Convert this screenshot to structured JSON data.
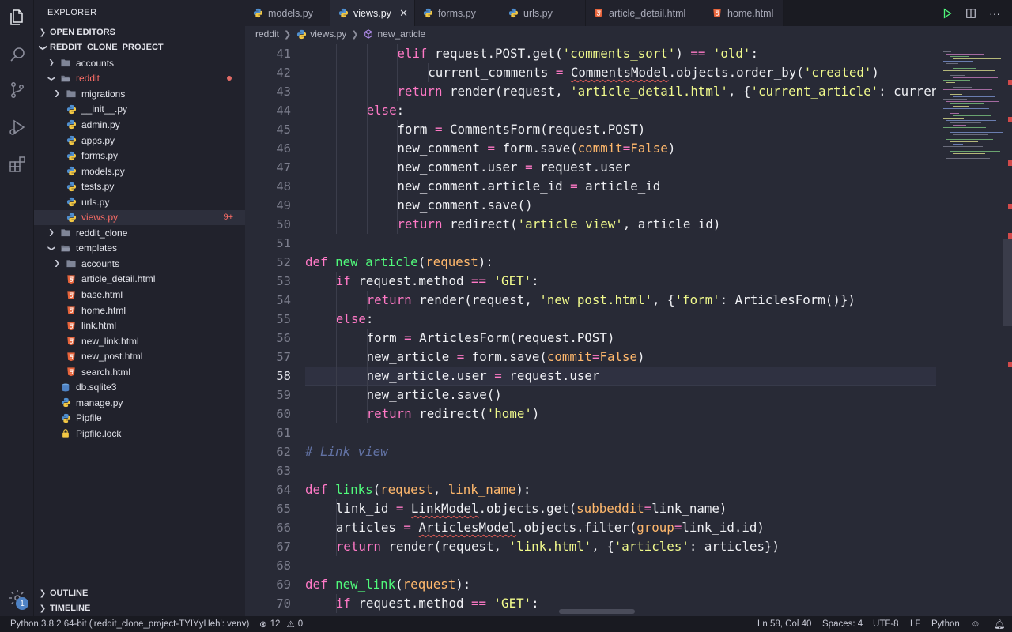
{
  "sidebar": {
    "header": "EXPLORER",
    "sections": {
      "open_editors": "OPEN EDITORS",
      "project": "REDDIT_CLONE_PROJECT",
      "outline": "OUTLINE",
      "timeline": "TIMELINE"
    },
    "tree": [
      {
        "label": "accounts",
        "type": "folder",
        "depth": 1,
        "expanded": false
      },
      {
        "label": "reddit",
        "type": "folder",
        "depth": 1,
        "expanded": true,
        "modified": true
      },
      {
        "label": "migrations",
        "type": "folder",
        "depth": 2,
        "expanded": false
      },
      {
        "label": "__init__.py",
        "type": "py",
        "depth": 2
      },
      {
        "label": "admin.py",
        "type": "py",
        "depth": 2
      },
      {
        "label": "apps.py",
        "type": "py",
        "depth": 2
      },
      {
        "label": "forms.py",
        "type": "py",
        "depth": 2
      },
      {
        "label": "models.py",
        "type": "py",
        "depth": 2
      },
      {
        "label": "tests.py",
        "type": "py",
        "depth": 2
      },
      {
        "label": "urls.py",
        "type": "py",
        "depth": 2
      },
      {
        "label": "views.py",
        "type": "py",
        "depth": 2,
        "active": true,
        "badge": "9+"
      },
      {
        "label": "reddit_clone",
        "type": "folder",
        "depth": 1,
        "expanded": false
      },
      {
        "label": "templates",
        "type": "folder",
        "depth": 1,
        "expanded": true
      },
      {
        "label": "accounts",
        "type": "folder",
        "depth": 2,
        "expanded": false
      },
      {
        "label": "article_detail.html",
        "type": "html",
        "depth": 2
      },
      {
        "label": "base.html",
        "type": "html",
        "depth": 2
      },
      {
        "label": "home.html",
        "type": "html",
        "depth": 2
      },
      {
        "label": "link.html",
        "type": "html",
        "depth": 2
      },
      {
        "label": "new_link.html",
        "type": "html",
        "depth": 2
      },
      {
        "label": "new_post.html",
        "type": "html",
        "depth": 2
      },
      {
        "label": "search.html",
        "type": "html",
        "depth": 2
      },
      {
        "label": "db.sqlite3",
        "type": "db",
        "depth": 1
      },
      {
        "label": "manage.py",
        "type": "py",
        "depth": 1
      },
      {
        "label": "Pipfile",
        "type": "pip",
        "depth": 1
      },
      {
        "label": "Pipfile.lock",
        "type": "lock",
        "depth": 1
      }
    ],
    "settings_badge": "1"
  },
  "tabs": [
    {
      "label": "models.py",
      "type": "py"
    },
    {
      "label": "views.py",
      "type": "py",
      "active": true
    },
    {
      "label": "forms.py",
      "type": "py"
    },
    {
      "label": "urls.py",
      "type": "py"
    },
    {
      "label": "article_detail.html",
      "type": "html"
    },
    {
      "label": "home.html",
      "type": "html"
    }
  ],
  "breadcrumb": [
    "reddit",
    "views.py",
    "new_article"
  ],
  "editor": {
    "current_line": 58,
    "lines": [
      {
        "n": "41",
        "indent": 3,
        "html": "<span class='k'>elif</span> request.POST.get(<span class='s'>'comments_sort'</span>) <span class='k'>==</span> <span class='s'>'old'</span>:"
      },
      {
        "n": "42",
        "indent": 4,
        "html": "current_comments <span class='k'>=</span> <span class='sq'>CommentsModel</span>.objects.order_by(<span class='s'>'created'</span>)"
      },
      {
        "n": "43",
        "indent": 3,
        "html": "<span class='k'>return</span> render(request, <span class='s'>'article_detail.html'</span>, {<span class='s'>'current_article'</span>: current_article, <span class='s'>'current_comments'</span>: current_comments})"
      },
      {
        "n": "44",
        "indent": 2,
        "html": "<span class='k'>else</span>:"
      },
      {
        "n": "45",
        "indent": 3,
        "html": "form <span class='k'>=</span> CommentsForm(request.POST)"
      },
      {
        "n": "46",
        "indent": 3,
        "html": "new_comment <span class='k'>=</span> form.save(<span class='p'>commit</span><span class='k'>=</span><span class='p'>False</span>)"
      },
      {
        "n": "47",
        "indent": 3,
        "html": "new_comment.user <span class='k'>=</span> request.user"
      },
      {
        "n": "48",
        "indent": 3,
        "html": "new_comment.article_id <span class='k'>=</span> article_id"
      },
      {
        "n": "49",
        "indent": 3,
        "html": "new_comment.save()"
      },
      {
        "n": "50",
        "indent": 3,
        "html": "<span class='k'>return</span> redirect(<span class='s'>'article_view'</span>, article_id)"
      },
      {
        "n": "51",
        "indent": 0,
        "html": ""
      },
      {
        "n": "52",
        "indent": 0,
        "html": "<span class='k'>def</span> <span class='fn'>new_article</span>(<span class='p'>request</span>):"
      },
      {
        "n": "53",
        "indent": 1,
        "html": "<span class='k'>if</span> request.method <span class='k'>==</span> <span class='s'>'GET'</span>:"
      },
      {
        "n": "54",
        "indent": 2,
        "html": "<span class='k'>return</span> render(request, <span class='s'>'new_post.html'</span>, {<span class='s'>'form'</span>: ArticlesForm()})"
      },
      {
        "n": "55",
        "indent": 1,
        "html": "<span class='k'>else</span>:"
      },
      {
        "n": "56",
        "indent": 2,
        "html": "form <span class='k'>=</span> ArticlesForm(request.POST)"
      },
      {
        "n": "57",
        "indent": 2,
        "html": "new_article <span class='k'>=</span> form.save(<span class='p'>commit</span><span class='k'>=</span><span class='p'>False</span>)"
      },
      {
        "n": "58",
        "indent": 2,
        "html": "new_article.user <span class='k'>=</span> request.user"
      },
      {
        "n": "59",
        "indent": 2,
        "html": "new_article.save()"
      },
      {
        "n": "60",
        "indent": 2,
        "html": "<span class='k'>return</span> redirect(<span class='s'>'home'</span>)"
      },
      {
        "n": "61",
        "indent": 0,
        "html": ""
      },
      {
        "n": "62",
        "indent": 0,
        "html": "<span class='c'># Link view</span>"
      },
      {
        "n": "63",
        "indent": 0,
        "html": ""
      },
      {
        "n": "64",
        "indent": 0,
        "html": "<span class='k'>def</span> <span class='fn'>links</span>(<span class='p'>request</span>, <span class='p'>link_name</span>):"
      },
      {
        "n": "65",
        "indent": 1,
        "html": "link_id <span class='k'>=</span> <span class='sq'>LinkModel</span>.objects.get(<span class='p'>subbeddit</span><span class='k'>=</span>link_name)"
      },
      {
        "n": "66",
        "indent": 1,
        "html": "articles <span class='k'>=</span> <span class='sq'>ArticlesModel</span>.objects.filter(<span class='p'>group</span><span class='k'>=</span>link_id.id)"
      },
      {
        "n": "67",
        "indent": 1,
        "html": "<span class='k'>return</span> render(request, <span class='s'>'link.html'</span>, {<span class='s'>'articles'</span>: articles})"
      },
      {
        "n": "68",
        "indent": 0,
        "html": ""
      },
      {
        "n": "69",
        "indent": 0,
        "html": "<span class='k'>def</span> <span class='fn'>new_link</span>(<span class='p'>request</span>):"
      },
      {
        "n": "70",
        "indent": 1,
        "html": "<span class='k'>if</span> request.method <span class='k'>==</span> <span class='s'>'GET'</span>:"
      }
    ]
  },
  "status": {
    "interpreter": "Python 3.8.2 64-bit ('reddit_clone_project-TYIYyHeh': venv)",
    "errors": "12",
    "warnings": "0",
    "position": "Ln 58, Col 40",
    "spaces": "Spaces: 4",
    "encoding": "UTF-8",
    "eol": "LF",
    "language": "Python"
  },
  "colors": {
    "background": "#282a36",
    "sidebar": "#21222c",
    "keyword": "#ff79c6",
    "string": "#f1fa8c",
    "function": "#50fa7b",
    "param": "#ffb86c",
    "modified": "#ff6e67"
  }
}
